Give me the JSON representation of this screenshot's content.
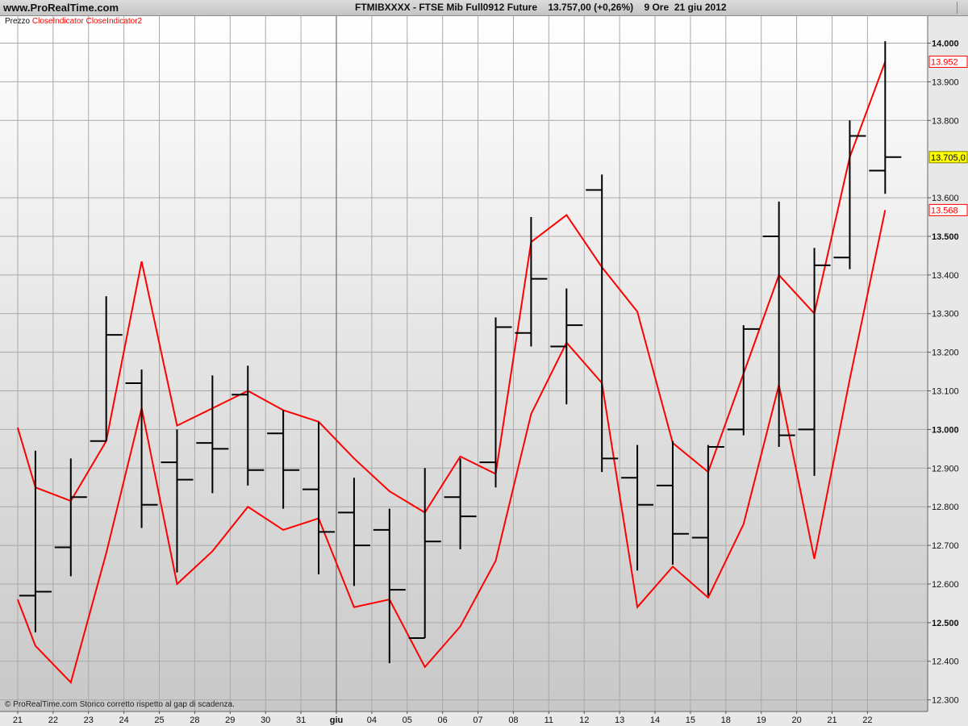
{
  "site": "www.ProRealTime.com",
  "header": {
    "symbol": "FTMIBXXXX - FTSE Mib Full0912 Future",
    "price_change": "13.757,00 (+0,26%)",
    "period": "9 Ore",
    "date": "21 giu 2012"
  },
  "legend": {
    "price": "Prezzo",
    "indicator1": "CloseIndicator",
    "indicator2": "CloseIndicator2"
  },
  "footnote": "© ProRealTime.com  Storico corretto rispetto al gap di scadenza.",
  "chart_data": {
    "type": "line",
    "xlabels": [
      "21",
      "22",
      "23",
      "24",
      "25",
      "28",
      "29",
      "30",
      "31",
      "giu",
      "04",
      "05",
      "06",
      "07",
      "08",
      "11",
      "12",
      "13",
      "14",
      "15",
      "18",
      "19",
      "20",
      "21",
      "22"
    ],
    "y_ticks": [
      {
        "value": 14000,
        "label": "14.000",
        "bold": true
      },
      {
        "value": 13900,
        "label": "13.900",
        "bold": false
      },
      {
        "value": 13800,
        "label": "13.800",
        "bold": false
      },
      {
        "value": 13600,
        "label": "13.600",
        "bold": false
      },
      {
        "value": 13500,
        "label": "13.500",
        "bold": true
      },
      {
        "value": 13400,
        "label": "13.400",
        "bold": false
      },
      {
        "value": 13300,
        "label": "13.300",
        "bold": false
      },
      {
        "value": 13200,
        "label": "13.200",
        "bold": false
      },
      {
        "value": 13100,
        "label": "13.100",
        "bold": false
      },
      {
        "value": 13000,
        "label": "13.000",
        "bold": true
      },
      {
        "value": 12900,
        "label": "12.900",
        "bold": false
      },
      {
        "value": 12800,
        "label": "12.800",
        "bold": false
      },
      {
        "value": 12700,
        "label": "12.700",
        "bold": false
      },
      {
        "value": 12600,
        "label": "12.600",
        "bold": false
      },
      {
        "value": 12500,
        "label": "12.500",
        "bold": true
      },
      {
        "value": 12400,
        "label": "12.400",
        "bold": false
      },
      {
        "value": 12300,
        "label": "12.300",
        "bold": false
      }
    ],
    "ylim": [
      12270,
      14070
    ],
    "xlim": [
      -0.5,
      25.7
    ],
    "price_bars": [
      {
        "x": 0.5,
        "o": 12570,
        "h": 12945,
        "l": 12475,
        "c": 12580
      },
      {
        "x": 1.5,
        "o": 12695,
        "h": 12925,
        "l": 12620,
        "c": 12825
      },
      {
        "x": 2.5,
        "o": 12970,
        "h": 13345,
        "l": 12970,
        "c": 13245
      },
      {
        "x": 3.5,
        "o": 13120,
        "h": 13155,
        "l": 12745,
        "c": 12805
      },
      {
        "x": 4.5,
        "o": 12915,
        "h": 13000,
        "l": 12630,
        "c": 12870
      },
      {
        "x": 5.5,
        "o": 12965,
        "h": 13140,
        "l": 12835,
        "c": 12950
      },
      {
        "x": 6.5,
        "o": 13090,
        "h": 13165,
        "l": 12855,
        "c": 12895
      },
      {
        "x": 7.5,
        "o": 12990,
        "h": 13050,
        "l": 12795,
        "c": 12895
      },
      {
        "x": 8.5,
        "o": 12845,
        "h": 13020,
        "l": 12625,
        "c": 12735
      },
      {
        "x": 9.5,
        "o": 12785,
        "h": 12875,
        "l": 12595,
        "c": 12700
      },
      {
        "x": 10.5,
        "o": 12740,
        "h": 12795,
        "l": 12395,
        "c": 12585
      },
      {
        "x": 11.5,
        "o": 12460,
        "h": 12900,
        "l": 12460,
        "c": 12710
      },
      {
        "x": 12.5,
        "o": 12825,
        "h": 12925,
        "l": 12690,
        "c": 12775
      },
      {
        "x": 13.5,
        "o": 12915,
        "h": 13290,
        "l": 12850,
        "c": 13265
      },
      {
        "x": 14.5,
        "o": 13250,
        "h": 13550,
        "l": 13215,
        "c": 13390
      },
      {
        "x": 15.5,
        "o": 13215,
        "h": 13365,
        "l": 13065,
        "c": 13270
      },
      {
        "x": 16.5,
        "o": 13620,
        "h": 13660,
        "l": 12890,
        "c": 12925
      },
      {
        "x": 17.5,
        "o": 12875,
        "h": 12960,
        "l": 12635,
        "c": 12805
      },
      {
        "x": 18.5,
        "o": 12855,
        "h": 12970,
        "l": 12650,
        "c": 12730
      },
      {
        "x": 19.5,
        "o": 12720,
        "h": 12960,
        "l": 12570,
        "c": 12955
      },
      {
        "x": 20.5,
        "o": 13000,
        "h": 13270,
        "l": 12985,
        "c": 13260
      },
      {
        "x": 21.5,
        "o": 13500,
        "h": 13590,
        "l": 12955,
        "c": 12985
      },
      {
        "x": 22.5,
        "o": 13000,
        "h": 13470,
        "l": 12880,
        "c": 13425
      },
      {
        "x": 23.5,
        "o": 13445,
        "h": 13800,
        "l": 13415,
        "c": 13760
      },
      {
        "x": 24.5,
        "o": 13670,
        "h": 14005,
        "l": 13610,
        "c": 13705
      }
    ],
    "series": [
      {
        "name": "CloseIndicator",
        "color": "#ff0000",
        "points": [
          [
            0,
            13005
          ],
          [
            0.5,
            12850
          ],
          [
            1.5,
            12815
          ],
          [
            2.5,
            12970
          ],
          [
            3.5,
            13435
          ],
          [
            4.5,
            13010
          ],
          [
            5.5,
            13055
          ],
          [
            6.5,
            13100
          ],
          [
            7.5,
            13050
          ],
          [
            8.5,
            13020
          ],
          [
            9.5,
            12925
          ],
          [
            10.5,
            12840
          ],
          [
            11.5,
            12785
          ],
          [
            12.5,
            12930
          ],
          [
            13.5,
            12885
          ],
          [
            14.5,
            13485
          ],
          [
            15.5,
            13555
          ],
          [
            16.5,
            13420
          ],
          [
            17.5,
            13305
          ],
          [
            18.5,
            12965
          ],
          [
            19.5,
            12890
          ],
          [
            20.5,
            13145
          ],
          [
            21.5,
            13400
          ],
          [
            22.5,
            13300
          ],
          [
            23.5,
            13705
          ],
          [
            24.5,
            13952
          ]
        ]
      },
      {
        "name": "CloseIndicator2",
        "color": "#ff0000",
        "points": [
          [
            0,
            12560
          ],
          [
            0.5,
            12440
          ],
          [
            1.5,
            12345
          ],
          [
            2.5,
            12680
          ],
          [
            3.5,
            13055
          ],
          [
            4.5,
            12600
          ],
          [
            5.5,
            12685
          ],
          [
            6.5,
            12800
          ],
          [
            7.5,
            12740
          ],
          [
            8.5,
            12770
          ],
          [
            9.5,
            12540
          ],
          [
            10.5,
            12560
          ],
          [
            11.5,
            12385
          ],
          [
            12.5,
            12490
          ],
          [
            13.5,
            12660
          ],
          [
            14.5,
            13040
          ],
          [
            15.5,
            13225
          ],
          [
            16.5,
            13120
          ],
          [
            17.5,
            12540
          ],
          [
            18.5,
            12645
          ],
          [
            19.5,
            12565
          ],
          [
            20.5,
            12755
          ],
          [
            21.5,
            13115
          ],
          [
            22.5,
            12665
          ],
          [
            23.5,
            13130
          ],
          [
            24.5,
            13568
          ]
        ]
      }
    ],
    "value_tags": [
      {
        "label": "13.952",
        "value": 13952,
        "text_color": "#ff0000",
        "bg": "#ffffff",
        "border": "#ff0000"
      },
      {
        "label": "13.705,0",
        "value": 13705,
        "text_color": "#000000",
        "bg": "#ffff00",
        "border": "#808000"
      },
      {
        "label": "13.568",
        "value": 13568,
        "text_color": "#ff0000",
        "bg": "#ffffff",
        "border": "#ff0000"
      }
    ]
  }
}
